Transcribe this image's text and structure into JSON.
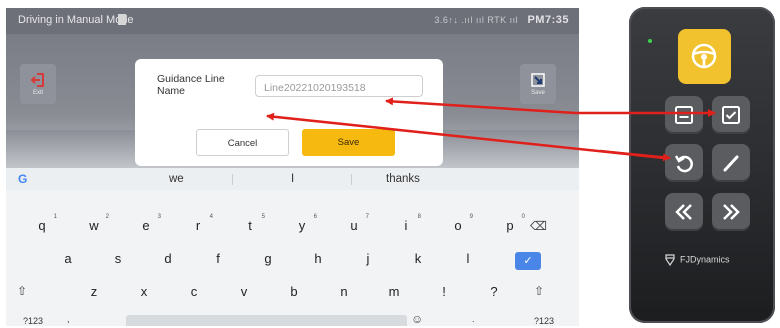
{
  "status_bar": {
    "title": "Driving in Manual Mode",
    "signal_text": "3.6↑↓  .ııl  ııl  RTK ııl",
    "time": "PM7:35"
  },
  "app": {
    "exit_label": "Exit",
    "save_label": "Save"
  },
  "dialog": {
    "label": "Guidance Line Name",
    "input_value": "Line20221020193518",
    "cancel_label": "Cancel",
    "save_label": "Save",
    "save_color": "#f6b90f"
  },
  "keyboard": {
    "suggestions": [
      "we",
      "I",
      "thanks"
    ],
    "row1": [
      {
        "k": "q",
        "h": "1"
      },
      {
        "k": "w",
        "h": "2"
      },
      {
        "k": "e",
        "h": "3"
      },
      {
        "k": "r",
        "h": "4"
      },
      {
        "k": "t",
        "h": "5"
      },
      {
        "k": "y",
        "h": "6"
      },
      {
        "k": "u",
        "h": "7"
      },
      {
        "k": "i",
        "h": "8"
      },
      {
        "k": "o",
        "h": "9"
      },
      {
        "k": "p",
        "h": "0"
      }
    ],
    "row2": [
      "a",
      "s",
      "d",
      "f",
      "g",
      "h",
      "j",
      "k",
      "l"
    ],
    "row3": [
      "z",
      "x",
      "c",
      "v",
      "b",
      "n",
      "m",
      "!",
      "?"
    ],
    "symbols_label": "?123",
    "comma": ",",
    "period": ".",
    "right_symbols_label": "?123",
    "enter_color": "#4a86e8"
  },
  "remote": {
    "brand": "FJDynamics",
    "auto_button_color": "#f2c12e",
    "icons": [
      "steering-wheel-icon",
      "list-icon",
      "checkbox-icon",
      "undo-icon",
      "line-icon",
      "double-chevron-left-icon",
      "double-chevron-right-icon"
    ]
  },
  "arrows": {
    "color": "#e0201b"
  }
}
